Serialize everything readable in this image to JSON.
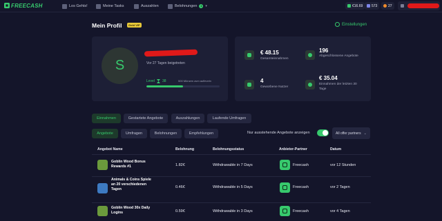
{
  "brand": {
    "name": "FREECASH",
    "color": "#37c96d"
  },
  "nav": {
    "items": [
      {
        "label": "Los Gehts!",
        "icon": "home-icon"
      },
      {
        "label": "Meine Tasks",
        "icon": "tasks-icon"
      },
      {
        "label": "Auszahlen",
        "icon": "cashout-icon"
      },
      {
        "label": "Belohnungen",
        "icon": "rewards-icon",
        "badge": "1"
      }
    ]
  },
  "balances": {
    "cash": "€16.69",
    "coins": "573",
    "streak": "27"
  },
  "profile": {
    "title": "Mein Profil",
    "vip_badge": "Gold VIP",
    "settings_label": "Einstellungen",
    "avatar_letter": "S",
    "joined": "Vor 27 Tagen beigetreten",
    "level_label": "Level",
    "level": "38",
    "next_level_text": "500 Münzen zum aufleveln",
    "level_progress": 0.5
  },
  "stats": [
    {
      "value": "€ 48.15",
      "label": "Gesamteinnahmen",
      "icon": "coins-icon"
    },
    {
      "value": "196",
      "label": "Abgeschlossene Angebote",
      "icon": "check-icon"
    },
    {
      "value": "4",
      "label": "Geworbene Nutzer",
      "icon": "users-icon"
    },
    {
      "value": "€ 35.04",
      "label": "Einnahmen der letzten 30 Tage",
      "icon": "clock-icon"
    }
  ],
  "tabs_primary": [
    "Einnahmen",
    "Gestartete Angebote",
    "Auszahlungen",
    "Laufende Umfragen"
  ],
  "tabs_secondary": [
    "Angebote",
    "Umfragen",
    "Belohnungen",
    "Empfehlungen"
  ],
  "filter": {
    "toggle_label": "Nur ausstehende Angebote anzeigen",
    "toggle_on": true,
    "partner_select": "All offer partners"
  },
  "table": {
    "headers": [
      "Angebot Name",
      "Belohnung",
      "Belohnungsstatus",
      "Anbieter-Partner",
      "Datum"
    ],
    "rows": [
      {
        "name": "Goblin Wood Bonus Rewards #1",
        "reward": "1.82€",
        "status": "Withdrawable in 7 Days",
        "partner": "Freecash",
        "date": "vor 12 Stunden",
        "icon_color": "#6b9a3c"
      },
      {
        "name": "Animals & Coins Spiele an 20 verschiedenen Tagen",
        "reward": "0.46€",
        "status": "Withdrawable in 5 Days",
        "partner": "Freecash",
        "date": "vor 2 Tagen",
        "icon_color": "#3d7ac2"
      },
      {
        "name": "Goblin Wood 30x Daily Logins",
        "reward": "0.59€",
        "status": "Withdrawable in 3 Days",
        "partner": "Freecash",
        "date": "vor 4 Tagen",
        "icon_color": "#6b9a3c"
      }
    ]
  }
}
